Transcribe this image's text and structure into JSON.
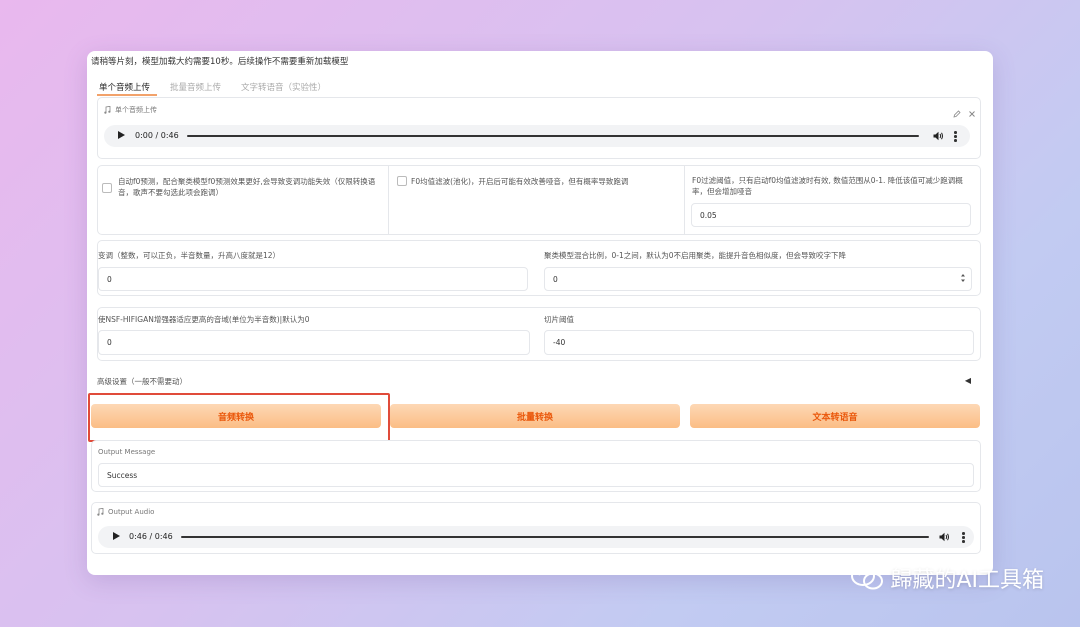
{
  "notice": "请稍等片刻，模型加载大约需要10秒。后续操作不需要重新加载模型",
  "tabs": [
    "单个音频上传",
    "批量音频上传",
    "文字转语音（实验性）"
  ],
  "upload": {
    "label": "单个音频上传",
    "time": "0:00 / 0:46"
  },
  "options": {
    "auto_f0": "自动f0预测，配合聚类模型f0预测效果更好,会导致变调功能失效（仅限转换语音，歌声不要勾选此项会跑调）",
    "f0_filter": "F0均值滤波(池化)，开启后可能有效改善哑音，但有概率导致跑调",
    "f0_threshold_label": "F0过滤阈值，只有启动f0均值滤波时有效, 数值范围从0-1. 降低该值可减少跑调概率，但会增加哑音",
    "f0_threshold_value": "0.05"
  },
  "pitch": {
    "label": "变调（整数，可以正负，半音数量，升高八度就是12）",
    "value": "0"
  },
  "cluster": {
    "label": "聚类模型混合比例，0-1之间，默认为0不启用聚类，能提升音色相似度，但会导致咬字下降",
    "value": "0"
  },
  "nsf": {
    "label": "使NSF-HIFIGAN增强器适应更高的音域(单位为半音数)|默认为0",
    "value": "0"
  },
  "slice": {
    "label": "切片阈值",
    "value": "-40"
  },
  "advanced": {
    "label": "高级设置（一般不需要动）",
    "arrow": "◀"
  },
  "buttons": {
    "convert": "音频转换",
    "batch": "批量转换",
    "tts": "文本转语音"
  },
  "output_message": {
    "label": "Output Message",
    "value": "Success"
  },
  "output_audio": {
    "label": "Output Audio",
    "time": "0:46 / 0:46"
  },
  "watermark": "歸藏的AI工具箱",
  "colors": {
    "accent": "#ea580c",
    "button_top": "#fdd8b5",
    "button_bottom": "#fbbd85",
    "highlight": "#e04b3a"
  }
}
